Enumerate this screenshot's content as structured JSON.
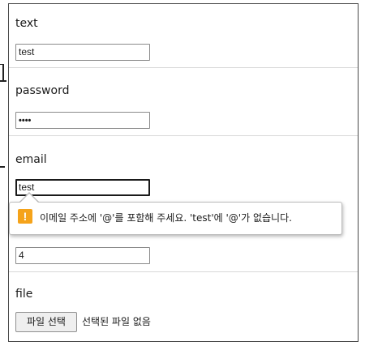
{
  "form": {
    "fields": [
      {
        "label": "text",
        "value": "test"
      },
      {
        "label": "password",
        "value": "••••"
      },
      {
        "label": "email",
        "value": "test"
      },
      {
        "label": "",
        "value": "4"
      },
      {
        "label": "file"
      }
    ],
    "file_button_label": "파일 선택",
    "file_status": "선택된 파일 없음"
  },
  "validation_tooltip": {
    "icon": "warning-icon",
    "icon_glyph": "!",
    "icon_color": "#f5a31a",
    "message": "이메일 주소에 '@'를 포함해 주세요. 'test'에 '@'가 없습니다."
  }
}
